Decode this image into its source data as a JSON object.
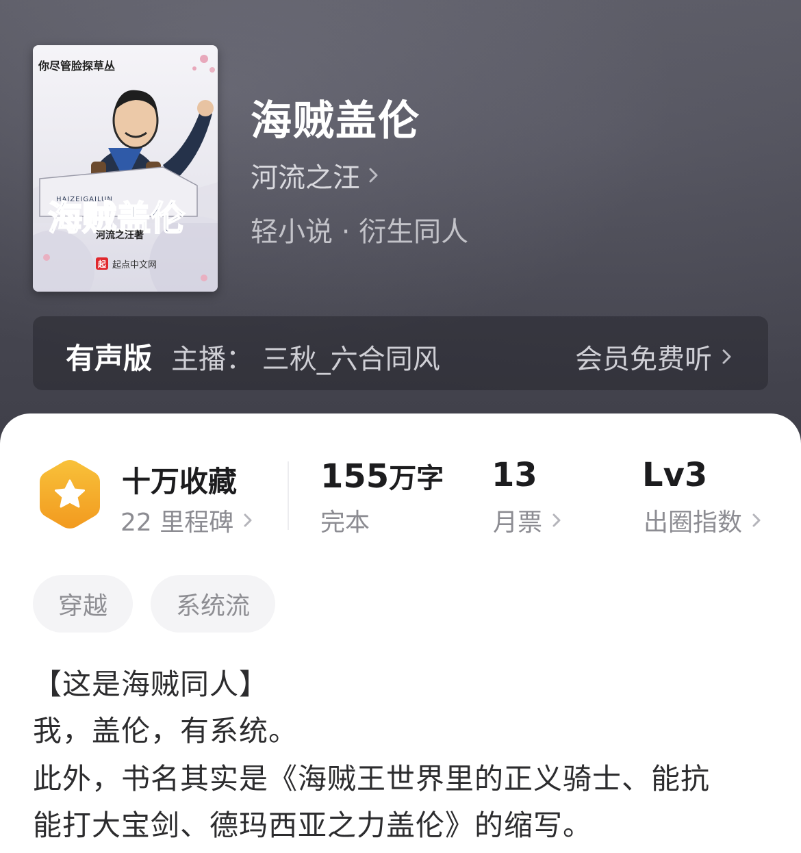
{
  "book": {
    "title": "海贼盖伦",
    "author": "河流之汪",
    "meta": "轻小说 · 衍生同人",
    "cover": {
      "top_text": "你尽管脸探草丛",
      "logo_title": "海贼盖伦",
      "pinyin": "HAIZEIGAILUN",
      "author": "河流之汪著",
      "publisher": "起点中文网",
      "publisher_badge": "起"
    }
  },
  "audio": {
    "label": "有声版",
    "host": "主播：  三秋_六合同风",
    "cta": "会员免费听"
  },
  "stats": {
    "collect": {
      "main": "十万收藏",
      "sub": "22 里程碑"
    },
    "words": {
      "number": "155",
      "unit": "万字",
      "sub": "完本"
    },
    "tickets": {
      "number": "13",
      "sub": "月票"
    },
    "level": {
      "number": "Lv3",
      "sub": "出圈指数"
    }
  },
  "tags": [
    "穿越",
    "系统流"
  ],
  "description": [
    "【这是海贼同人】",
    "我，盖伦，有系统。",
    "此外，书名其实是《海贼王世界里的正义骑士、能抗",
    "能打大宝剑、德玛西亚之力盖伦》的缩写。"
  ],
  "colors": {
    "header_bg": "#4b4b55",
    "badge_orange": "#f5a623",
    "text_dark": "#1c1c1e",
    "text_gray": "#8c8c92"
  },
  "icons": [
    "chevron-right-icon",
    "star-hexagon-icon"
  ]
}
